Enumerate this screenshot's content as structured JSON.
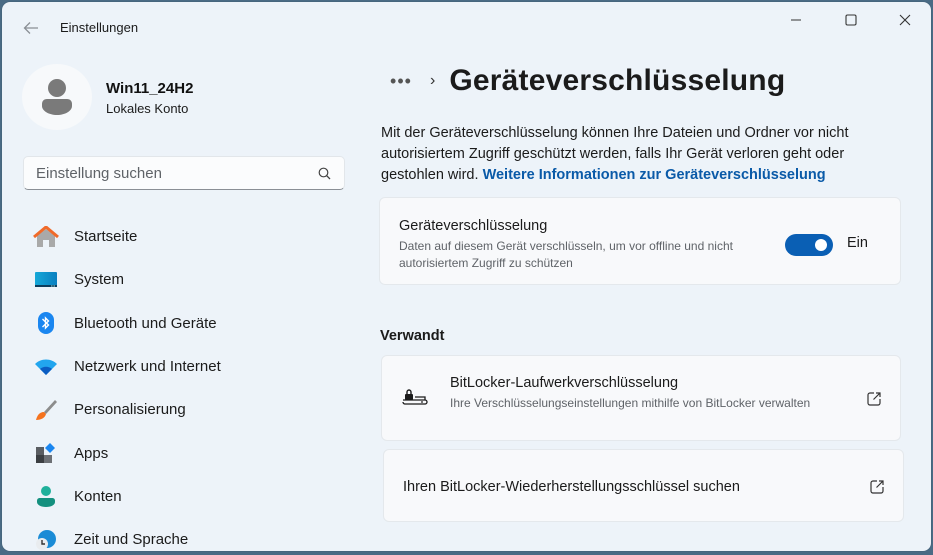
{
  "window": {
    "app_title": "Einstellungen",
    "controls": {
      "minimize": "minimize",
      "maximize": "maximize",
      "close": "close"
    }
  },
  "profile": {
    "name": "Win11_24H2",
    "account_type": "Lokales Konto"
  },
  "search": {
    "placeholder": "Einstellung suchen",
    "value": ""
  },
  "sidebar": {
    "items": [
      {
        "label": "Startseite",
        "icon": "home-icon"
      },
      {
        "label": "System",
        "icon": "system-icon"
      },
      {
        "label": "Bluetooth und Geräte",
        "icon": "bluetooth-icon"
      },
      {
        "label": "Netzwerk und Internet",
        "icon": "wifi-icon"
      },
      {
        "label": "Personalisierung",
        "icon": "brush-icon"
      },
      {
        "label": "Apps",
        "icon": "apps-icon"
      },
      {
        "label": "Konten",
        "icon": "account-icon"
      },
      {
        "label": "Zeit und Sprache",
        "icon": "time-language-icon"
      }
    ]
  },
  "main": {
    "breadcrumb_more": "•••",
    "breadcrumb_separator": "›",
    "page_title": "Geräteverschlüsselung",
    "description": "Mit der Geräteverschlüsselung können Ihre Dateien und Ordner vor nicht autorisiertem Zugriff geschützt werden, falls Ihr Gerät verloren geht oder gestohlen wird.",
    "learn_more_link": "Weitere Informationen zur Geräteverschlüsselung",
    "encryption_setting": {
      "title": "Geräteverschlüsselung",
      "description": "Daten auf diesem Gerät verschlüsseln, um vor offline und nicht autorisiertem Zugriff zu schützen",
      "enabled": true,
      "state_label": "Ein"
    },
    "related": {
      "title": "Verwandt",
      "items": [
        {
          "title": "BitLocker-Laufwerkverschlüsselung",
          "description": "Ihre Verschlüsselungseinstellungen mithilfe von BitLocker verwalten",
          "icon": "bitlocker-drive-icon",
          "action_icon": "external-link-icon"
        },
        {
          "title": "Ihren BitLocker-Wiederherstellungsschlüssel suchen",
          "action_icon": "external-link-icon"
        }
      ]
    }
  },
  "colors": {
    "accent": "#0a5fb4",
    "link": "#0a5aa8",
    "window_bg": "#edf3f9",
    "card_bg": "#f8f9fb"
  }
}
